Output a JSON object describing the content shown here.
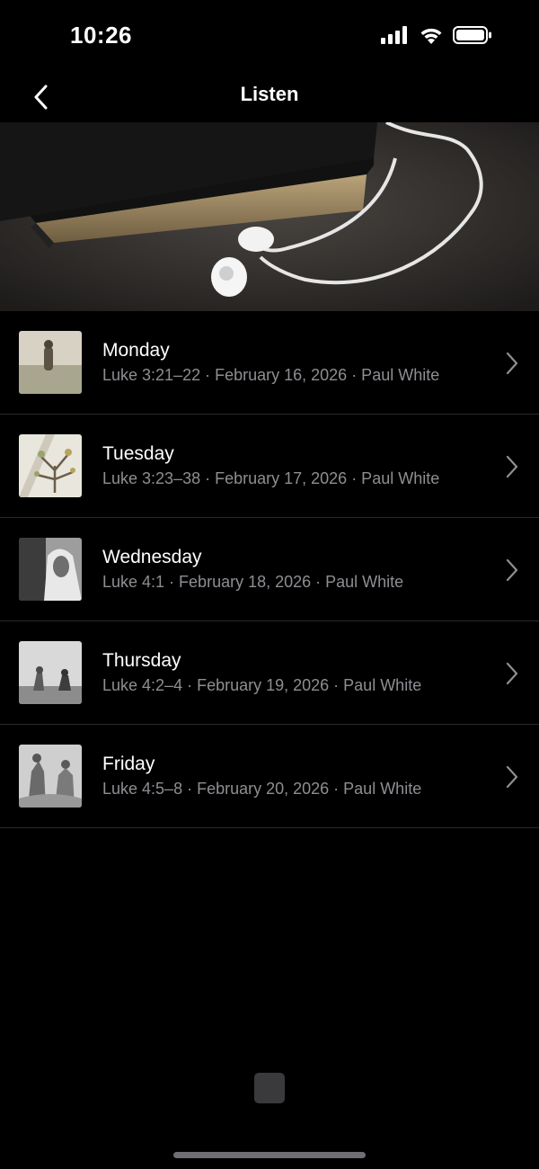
{
  "status_bar": {
    "time": "10:26"
  },
  "nav": {
    "title": "Listen",
    "back_icon": "chevron-left-icon"
  },
  "hero": {
    "description_icon": "bible-with-earbuds-image"
  },
  "items": [
    {
      "title": "Monday",
      "subtitle": "Luke 3:21–22 · February 16, 2026 · Paul White"
    },
    {
      "title": "Tuesday",
      "subtitle": "Luke 3:23–38 · February 17, 2026 · Paul White"
    },
    {
      "title": "Wednesday",
      "subtitle": "Luke 4:1 · February 18, 2026 · Paul White"
    },
    {
      "title": "Thursday",
      "subtitle": "Luke 4:2–4 · February 19, 2026 · Paul White"
    },
    {
      "title": "Friday",
      "subtitle": "Luke 4:5–8 · February 20, 2026 · Paul White"
    }
  ],
  "colors": {
    "background": "#000000",
    "subtitle": "#8e8e93",
    "separator": "#2a2a2a"
  }
}
